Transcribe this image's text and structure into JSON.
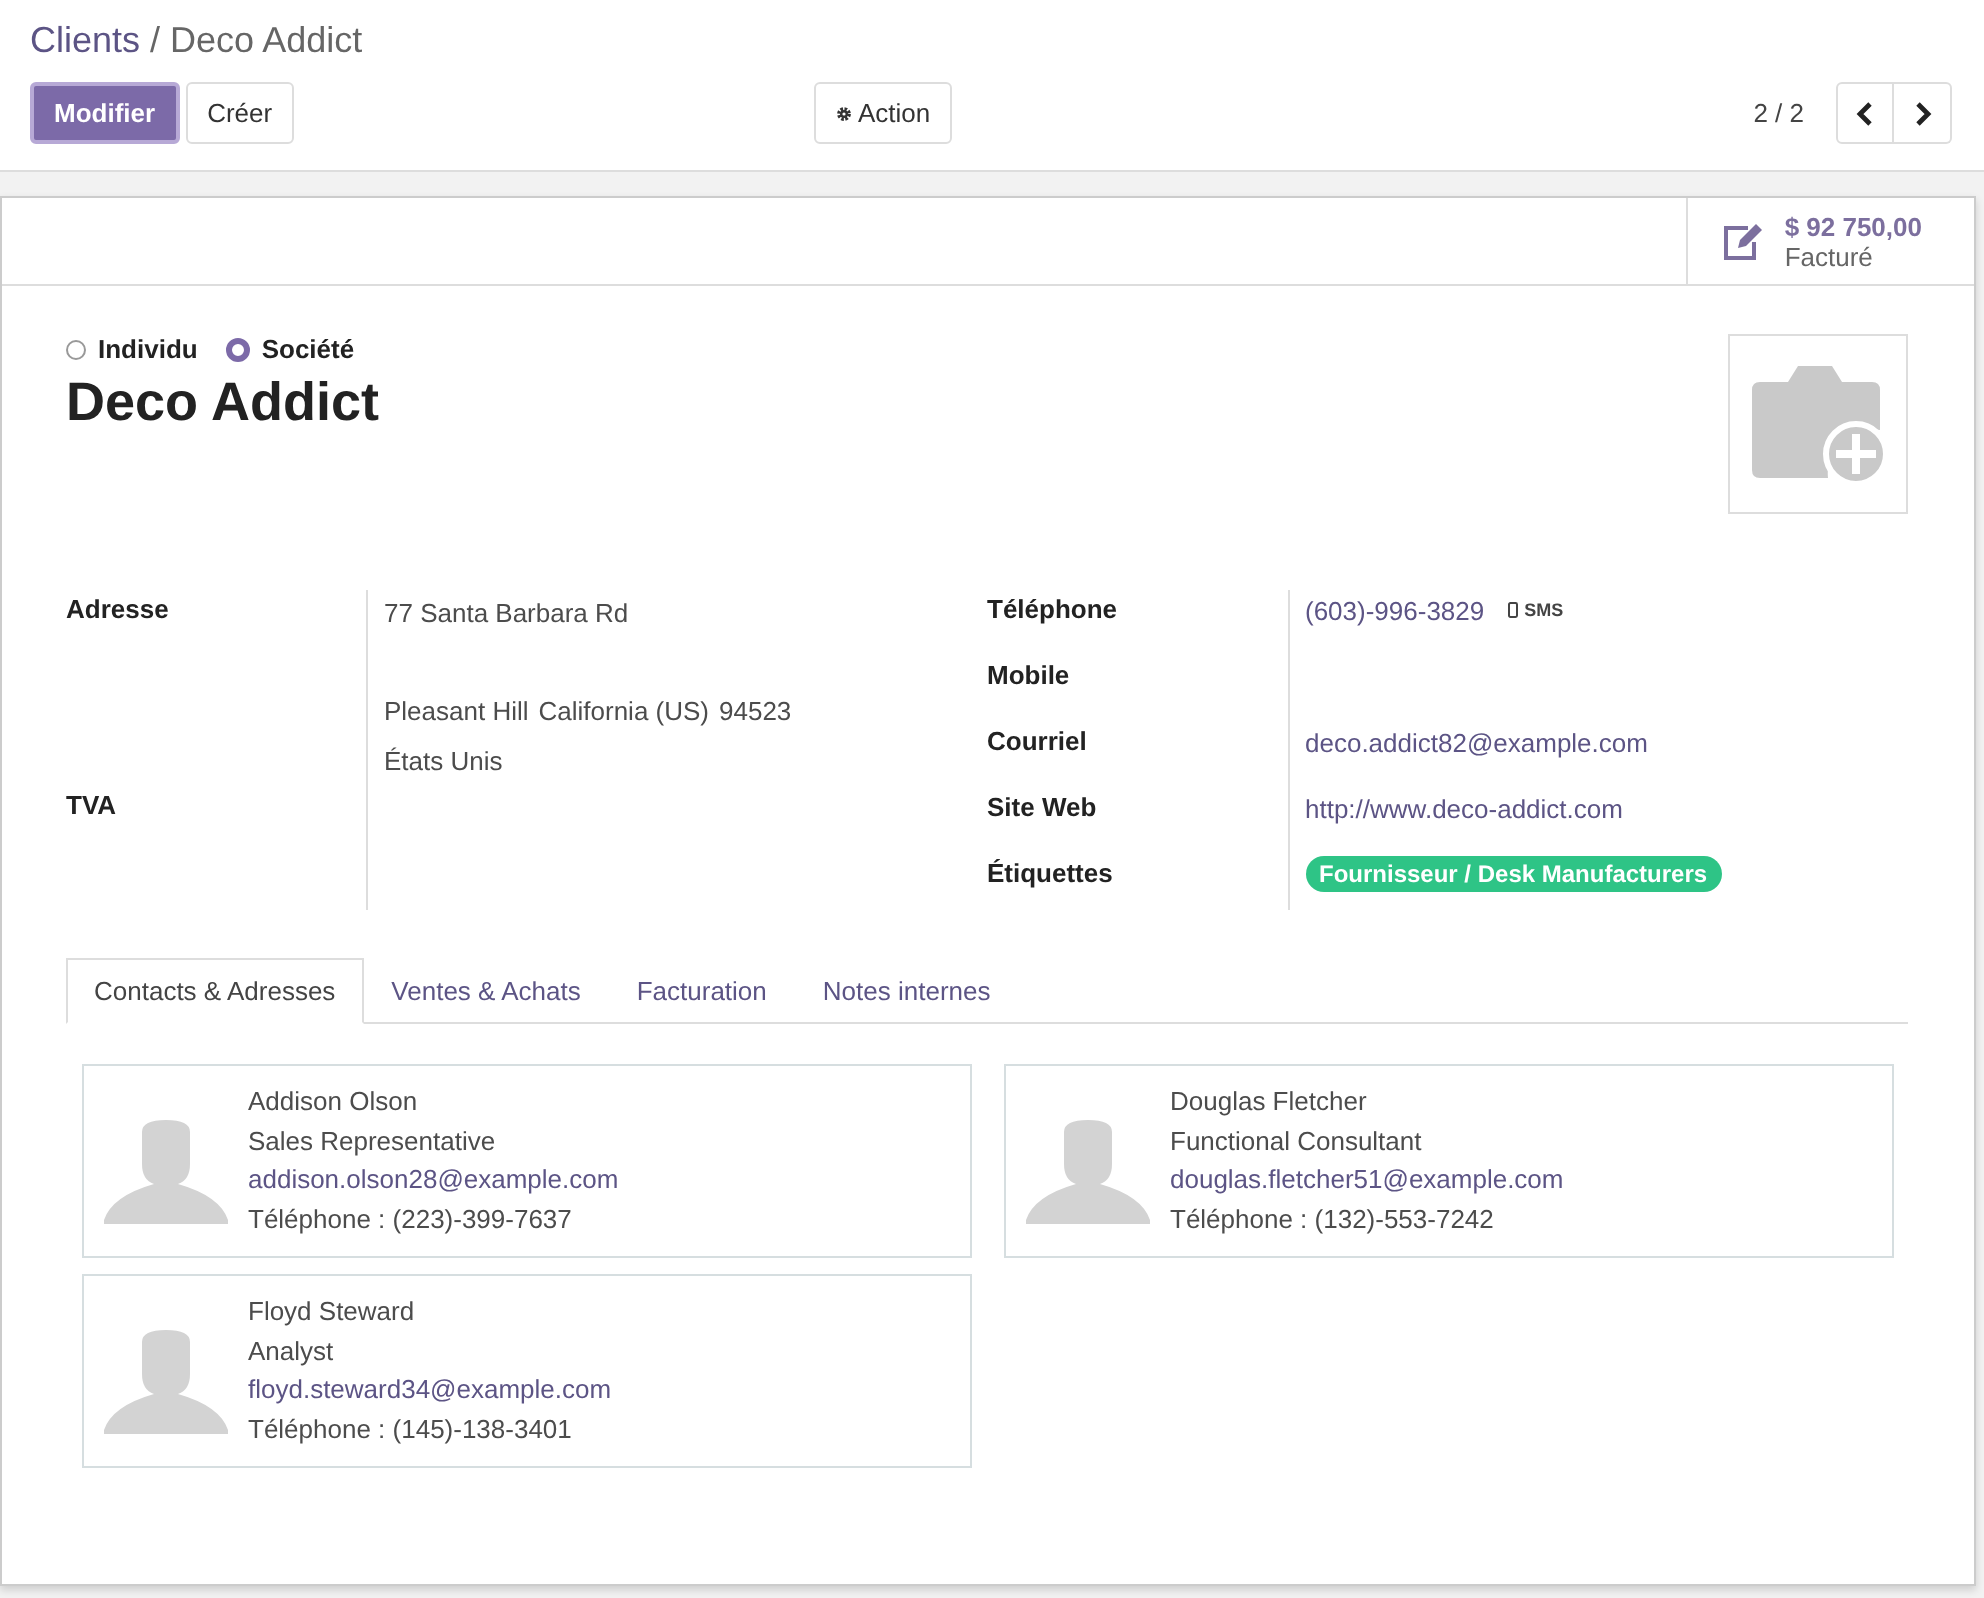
{
  "breadcrumb": {
    "parent": "Clients",
    "separator": "/",
    "current": "Deco Addict"
  },
  "buttons": {
    "edit": "Modifier",
    "create": "Créer",
    "action": "Action"
  },
  "pager": {
    "value": "2 / 2"
  },
  "stat_button": {
    "value": "$ 92 750,00",
    "label": "Facturé"
  },
  "company_type": [
    {
      "label": "Individu",
      "selected": false
    },
    {
      "label": "Société",
      "selected": true
    }
  ],
  "name": "Deco Addict",
  "address": {
    "label": "Adresse",
    "street": "77 Santa Barbara Rd",
    "city": "Pleasant Hill",
    "state": "California (US)",
    "zip": "94523",
    "country": "États Unis"
  },
  "vat": {
    "label": "TVA"
  },
  "fields": [
    {
      "label": "Téléphone",
      "value": "(603)-996-3829",
      "kind": "phone",
      "action": "SMS"
    },
    {
      "label": "Mobile",
      "kind": "empty"
    },
    {
      "label": "Courriel",
      "value": "deco.addict82@example.com",
      "kind": "link"
    },
    {
      "label": "Site Web",
      "value": "http://www.deco-addict.com",
      "kind": "link"
    },
    {
      "label": "Étiquettes",
      "kind": "tags",
      "tags": [
        {
          "label": "Fournisseur / Desk Manufacturers",
          "color": "#2ec486"
        }
      ]
    }
  ],
  "tabs": [
    {
      "label": "Contacts & Adresses",
      "selected": true
    },
    {
      "label": "Ventes & Achats",
      "selected": false
    },
    {
      "label": "Facturation",
      "selected": false
    },
    {
      "label": "Notes internes",
      "selected": false
    }
  ],
  "contacts": [
    {
      "name": "Addison Olson",
      "function": "Sales Representative",
      "email": "addison.olson28@example.com",
      "phone": "Téléphone : (223)-399-7637"
    },
    {
      "name": "Douglas Fletcher",
      "function": "Functional Consultant",
      "email": "douglas.fletcher51@example.com",
      "phone": "Téléphone : (132)-553-7242"
    },
    {
      "name": "Floyd Steward",
      "function": "Analyst",
      "email": "floyd.steward34@example.com",
      "phone": "Téléphone : (145)-138-3401"
    }
  ]
}
